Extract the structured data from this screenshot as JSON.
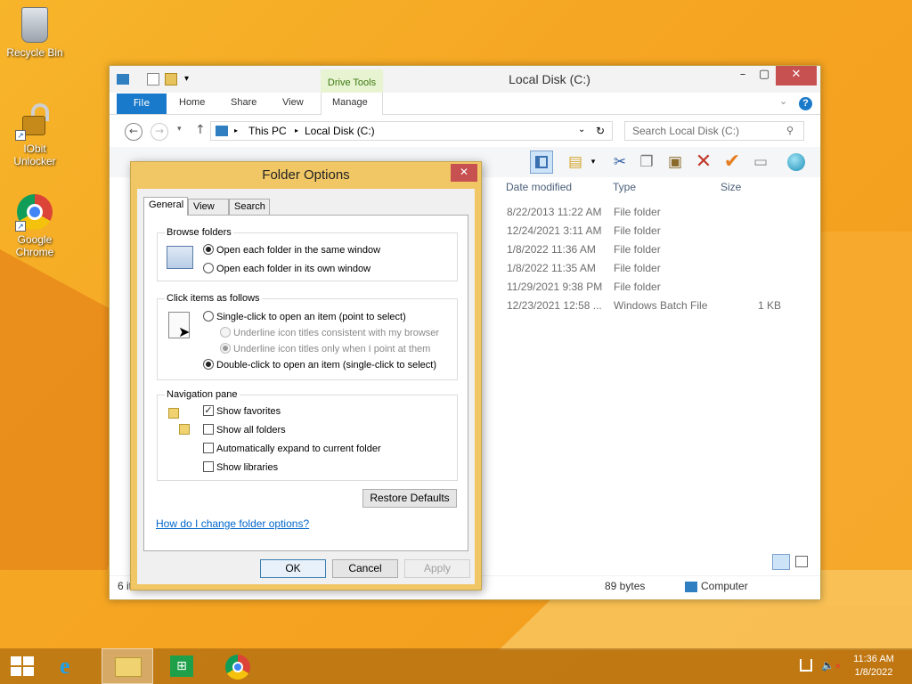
{
  "desktop": {
    "icons": [
      {
        "label": "Recycle Bin"
      },
      {
        "label": "IObit Unlocker"
      },
      {
        "label": "Google Chrome"
      }
    ]
  },
  "explorer": {
    "title": "Local Disk (C:)",
    "context_tab": "Drive Tools",
    "ribbon_tabs": {
      "file": "File",
      "home": "Home",
      "share": "Share",
      "view": "View",
      "manage": "Manage"
    },
    "breadcrumb": [
      "This PC",
      "Local Disk (C:)"
    ],
    "search_placeholder": "Search Local Disk (C:)",
    "columns": {
      "date": "Date modified",
      "type": "Type",
      "size": "Size"
    },
    "rows": [
      {
        "date": "8/22/2013 11:22 AM",
        "type": "File folder",
        "size": ""
      },
      {
        "date": "12/24/2021 3:11 AM",
        "type": "File folder",
        "size": ""
      },
      {
        "date": "1/8/2022 11:36 AM",
        "type": "File folder",
        "size": ""
      },
      {
        "date": "1/8/2022 11:35 AM",
        "type": "File folder",
        "size": ""
      },
      {
        "date": "11/29/2021 9:38 PM",
        "type": "File folder",
        "size": ""
      },
      {
        "date": "12/23/2021 12:58 ...",
        "type": "Windows Batch File",
        "size": "1 KB"
      }
    ],
    "status": {
      "items": "6 it",
      "size": "89 bytes",
      "location": "Computer"
    }
  },
  "dialog": {
    "title": "Folder Options",
    "tabs": {
      "general": "General",
      "view": "View",
      "search": "Search"
    },
    "browse": {
      "label": "Browse folders",
      "same_window": "Open each folder in the same window",
      "own_window": "Open each folder in its own window"
    },
    "click": {
      "label": "Click items as follows",
      "single": "Single-click to open an item (point to select)",
      "underline_browser": "Underline icon titles consistent with my browser",
      "underline_point": "Underline icon titles only when I point at them",
      "double": "Double-click to open an item (single-click to select)"
    },
    "nav": {
      "label": "Navigation pane",
      "favorites": "Show favorites",
      "all_folders": "Show all folders",
      "expand": "Automatically expand to current folder",
      "libraries": "Show libraries"
    },
    "restore": "Restore Defaults",
    "help_link": "How do I change folder options?",
    "ok": "OK",
    "cancel": "Cancel",
    "apply": "Apply"
  },
  "taskbar": {
    "time": "11:36 AM",
    "date": "1/8/2022"
  }
}
